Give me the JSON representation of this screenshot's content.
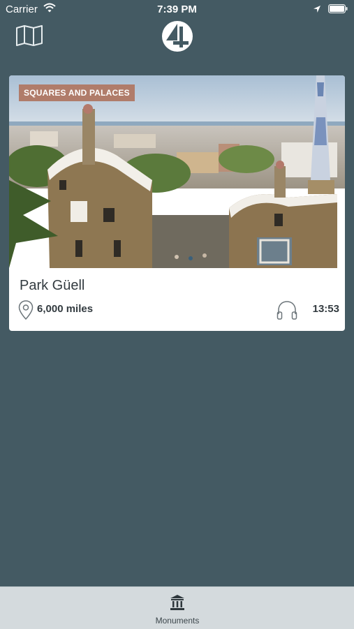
{
  "status_bar": {
    "carrier": "Carrier",
    "time": "7:39 PM"
  },
  "nav": {
    "left_icon": "map-icon",
    "logo_icon": "app-logo"
  },
  "card": {
    "category": "SQUARES AND PALACES",
    "title": "Park Güell",
    "distance": "6,000 miles",
    "duration": "13:53",
    "distance_icon": "location-pin-icon",
    "duration_icon": "headphones-icon"
  },
  "tab_bar": {
    "items": [
      {
        "label": "Monuments",
        "icon": "monument-icon"
      }
    ]
  },
  "colors": {
    "background": "#445a63",
    "badge": "#b07c6a",
    "tab_bar": "#d4dadd",
    "card": "#ffffff"
  }
}
